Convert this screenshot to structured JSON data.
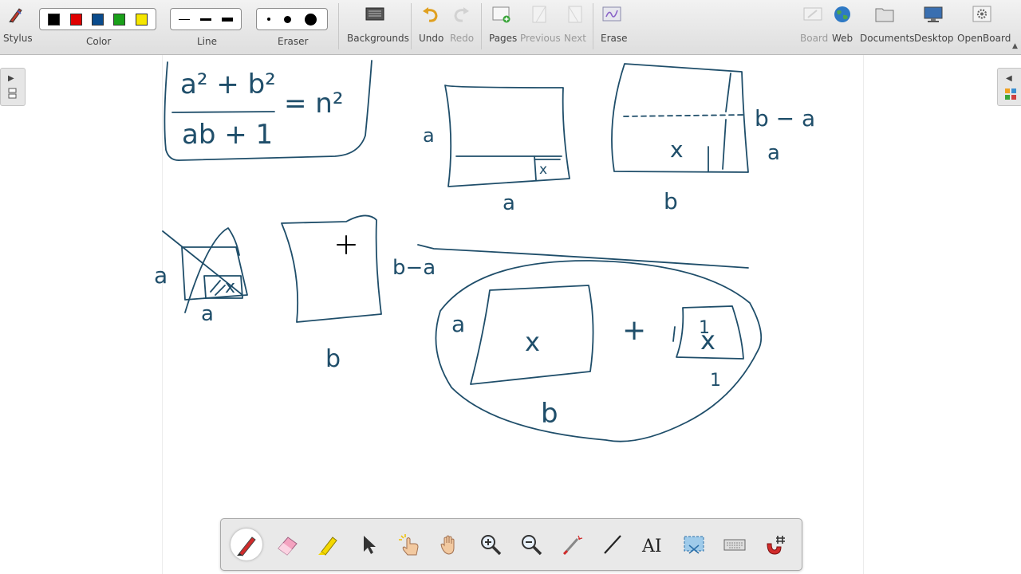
{
  "toolbar": {
    "stylus_label": "Stylus",
    "color_label": "Color",
    "line_label": "Line",
    "eraser_label": "Eraser",
    "backgrounds_label": "Backgrounds",
    "undo_label": "Undo",
    "redo_label": "Redo",
    "pages_label": "Pages",
    "previous_label": "Previous",
    "next_label": "Next",
    "erase_label": "Erase",
    "board_label": "Board",
    "web_label": "Web",
    "documents_label": "Documents",
    "desktop_label": "Desktop",
    "openboard_label": "OpenBoard",
    "colors": [
      "#000000",
      "#e00000",
      "#0a4b8c",
      "#1aa01a",
      "#f5e600"
    ]
  },
  "board": {
    "ink_color": "#1f4e6a",
    "equation": {
      "numerator": "a² + b²",
      "denominator": "ab + 1",
      "rhs": "= n²"
    },
    "labels": {
      "a1": "a",
      "a2": "a",
      "x1": "x",
      "bma": "b − a",
      "a3": "a",
      "x2": "x",
      "b1": "b",
      "a4": "a",
      "x3": "x",
      "a5": "a",
      "b2ma": "b−a",
      "b2": "b",
      "a6": "a",
      "x4": "x",
      "b3": "b",
      "plus": "+",
      "one1": "1",
      "x5": "x",
      "one2": "1"
    }
  },
  "dock": {
    "tools": [
      "pen-tool",
      "eraser-tool",
      "highlighter-tool",
      "selector-tool",
      "interact-tool",
      "hand-tool",
      "zoom-in-tool",
      "zoom-out-tool",
      "laser-pointer-tool",
      "line-tool",
      "text-tool",
      "capture-tool",
      "keyboard-tool",
      "magnet-tool"
    ],
    "active_tool": "pen-tool"
  }
}
